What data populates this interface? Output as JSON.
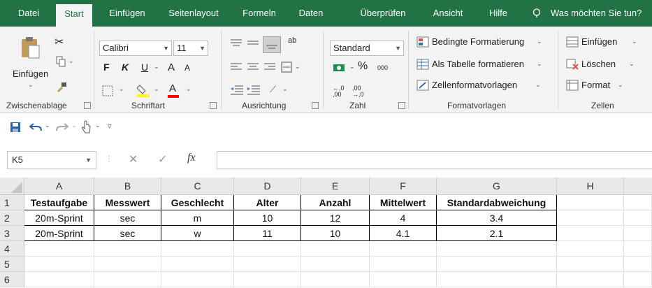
{
  "tabs": [
    "Datei",
    "Start",
    "Einfügen",
    "Seitenlayout",
    "Formeln",
    "Daten",
    "Überprüfen",
    "Ansicht",
    "Hilfe"
  ],
  "tell_me": "Was möchten Sie tun?",
  "colors": {
    "excel_green": "#217346",
    "ribbon_bg": "#f3f3f3",
    "highlight_yellow": "#ffff00",
    "font_red": "#ff0000"
  },
  "clipboard": {
    "paste_label": "Einfügen",
    "group": "Zwischenablage"
  },
  "font": {
    "name": "Calibri",
    "size": "11",
    "bold": "F",
    "italic": "K",
    "underline": "U",
    "grow": "A",
    "shrink": "A",
    "color_letter": "A",
    "group": "Schriftart"
  },
  "alignment": {
    "wrap": "ab",
    "group": "Ausrichtung"
  },
  "number": {
    "format": "Standard",
    "percent": "%",
    "thousands": "000",
    "inc_decimal": "←,0 ,00",
    "dec_decimal": ",00 →,0",
    "group": "Zahl"
  },
  "styles": {
    "conditional": "Bedingte Formatierung",
    "as_table": "Als Tabelle formatieren",
    "cell_styles": "Zellenformatvorlagen",
    "group": "Formatvorlagen"
  },
  "cells": {
    "insert": "Einfügen",
    "delete": "Löschen",
    "format": "Format",
    "group": "Zellen"
  },
  "formula_bar": {
    "name_box": "K5",
    "fx": "fx",
    "value": ""
  },
  "grid": {
    "columns": [
      "A",
      "B",
      "C",
      "D",
      "E",
      "F",
      "G",
      "H"
    ],
    "rows": [
      "1",
      "2",
      "3",
      "4",
      "5",
      "6"
    ],
    "data": [
      [
        "Testaufgabe",
        "Messwert",
        "Geschlecht",
        "Alter",
        "Anzahl",
        "Mittelwert",
        "Standardabweichung"
      ],
      [
        "20m-Sprint",
        "sec",
        "m",
        "10",
        "12",
        "4",
        "3.4"
      ],
      [
        "20m-Sprint",
        "sec",
        "w",
        "11",
        "10",
        "4.1",
        "2.1"
      ]
    ]
  }
}
